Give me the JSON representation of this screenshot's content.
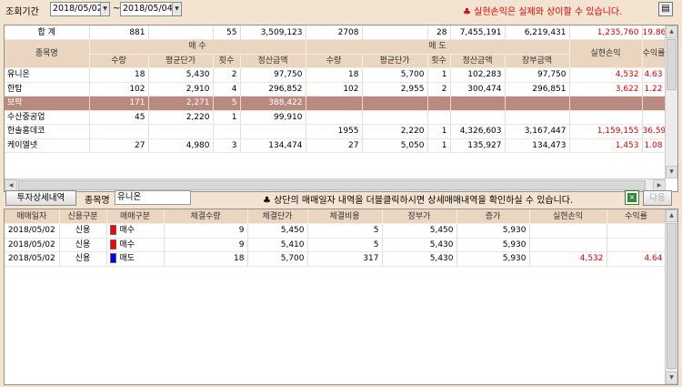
{
  "topbar": {
    "period_label": "조회기간",
    "date_from": "2018/05/02",
    "date_to": "2018/05/04",
    "tilde": "~",
    "warning": "♣ 실현손익은 실제와 상이할 수 있습니다."
  },
  "summary": {
    "columns": {
      "stock": "종목명",
      "buy_group": "매 수",
      "sell_group": "매 도",
      "qty": "수량",
      "avg_price": "평균단가",
      "count": "횟수",
      "settle_amount": "정산금액",
      "book_amount": "장부금액",
      "realized_pl": "실현손익",
      "return_rate": "수익률"
    },
    "total": {
      "label": "합 계",
      "buy_qty": "881",
      "buy_avg": "",
      "buy_count": "55",
      "buy_settle": "3,509,123",
      "sell_qty": "2708",
      "sell_avg": "",
      "sell_count": "28",
      "sell_settle": "7,455,191",
      "book": "6,219,431",
      "pl": "1,235,760",
      "rate": "19.86"
    },
    "rows": [
      {
        "name": "유니온",
        "buy_qty": "18",
        "buy_avg": "5,430",
        "buy_count": "2",
        "buy_settle": "97,750",
        "sell_qty": "18",
        "sell_avg": "5,700",
        "sell_count": "1",
        "sell_settle": "102,283",
        "book": "97,750",
        "pl": "4,532",
        "rate": "4.63"
      },
      {
        "name": "한탑",
        "buy_qty": "102",
        "buy_avg": "2,910",
        "buy_count": "4",
        "buy_settle": "296,852",
        "sell_qty": "102",
        "sell_avg": "2,955",
        "sell_count": "2",
        "sell_settle": "300,474",
        "book": "296,851",
        "pl": "3,622",
        "rate": "1.22"
      },
      {
        "name": "보락",
        "buy_qty": "171",
        "buy_avg": "2,271",
        "buy_count": "5",
        "buy_settle": "388,422",
        "sell_qty": "",
        "sell_avg": "",
        "sell_count": "",
        "sell_settle": "",
        "book": "",
        "pl": "",
        "rate": ""
      },
      {
        "name": "수산중공업",
        "buy_qty": "45",
        "buy_avg": "2,220",
        "buy_count": "1",
        "buy_settle": "99,910",
        "sell_qty": "",
        "sell_avg": "",
        "sell_count": "",
        "sell_settle": "",
        "book": "",
        "pl": "",
        "rate": ""
      },
      {
        "name": "한솔홈데코",
        "buy_qty": "",
        "buy_avg": "",
        "buy_count": "",
        "buy_settle": "",
        "sell_qty": "1955",
        "sell_avg": "2,220",
        "sell_count": "1",
        "sell_settle": "4,326,603",
        "book": "3,167,447",
        "pl": "1,159,155",
        "rate": "36.59"
      },
      {
        "name": "케이엘넷",
        "buy_qty": "27",
        "buy_avg": "4,980",
        "buy_count": "3",
        "buy_settle": "134,474",
        "sell_qty": "27",
        "sell_avg": "5,050",
        "sell_count": "1",
        "sell_settle": "135,927",
        "book": "134,473",
        "pl": "1,453",
        "rate": "1.08"
      }
    ]
  },
  "detailbar": {
    "invest_button": "투자상세내역",
    "stock_label": "종목명",
    "stock_value": "유니온",
    "hint": "♣ 상단의 매매일자 내역을 더블클릭하시면 상세매매내역을 확인하실 수 있습니다.",
    "next_button": "다음"
  },
  "detail": {
    "columns": {
      "date": "매매일자",
      "credit": "신용구분",
      "trade": "매매구분",
      "qty": "체결수량",
      "price": "체결단가",
      "cost": "체결비용",
      "book": "장부가",
      "cash": "증가",
      "pl": "실현손익",
      "rate": "수익률"
    },
    "rows": [
      {
        "date": "2018/05/02",
        "credit": "신용",
        "trade": "매수",
        "swatch": "#ff0000",
        "qty": "9",
        "price": "5,450",
        "cost": "5",
        "book": "5,450",
        "cash": "5,930",
        "pl": "",
        "rate": ""
      },
      {
        "date": "2018/05/02",
        "credit": "신용",
        "trade": "매수",
        "swatch": "#ff0000",
        "qty": "9",
        "price": "5,410",
        "cost": "5",
        "book": "5,430",
        "cash": "5,930",
        "pl": "",
        "rate": ""
      },
      {
        "date": "2018/05/02",
        "credit": "신용",
        "trade": "매도",
        "swatch": "#0000ff",
        "qty": "18",
        "price": "5,700",
        "cost": "317",
        "book": "5,430",
        "cash": "5,930",
        "pl": "4,532",
        "rate": "4.64"
      }
    ]
  },
  "colors": {
    "loss_profit_red": "#e00000",
    "selected_row": "#b98a80",
    "header_bg": "#ead5c0"
  }
}
